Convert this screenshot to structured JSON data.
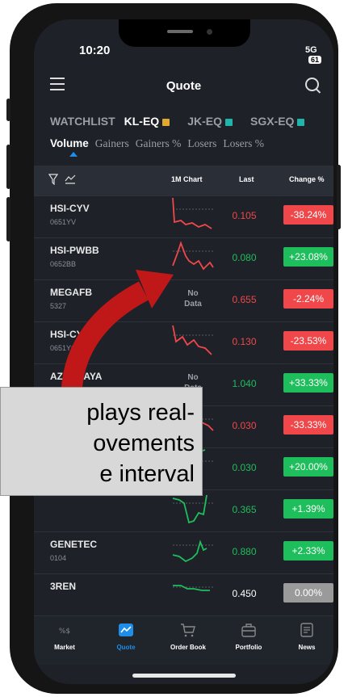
{
  "status_bar": {
    "time": "10:20",
    "network": "5G",
    "battery": "61"
  },
  "header": {
    "title": "Quote"
  },
  "market_tabs": [
    {
      "label": "WATCHLIST",
      "active": false,
      "marker_color": ""
    },
    {
      "label": "KL-EQ",
      "active": true,
      "marker_color": "#e0a82e"
    },
    {
      "label": "JK-EQ",
      "active": false,
      "marker_color": "#1fb5a8"
    },
    {
      "label": "SGX-EQ",
      "active": false,
      "marker_color": "#1fb5a8"
    }
  ],
  "sub_tabs": [
    {
      "label": "Volume",
      "active": true
    },
    {
      "label": "Gainers",
      "active": false
    },
    {
      "label": "Gainers %",
      "active": false
    },
    {
      "label": "Losers",
      "active": false
    },
    {
      "label": "Losers %",
      "active": false
    }
  ],
  "table": {
    "headers": {
      "chart": "1M Chart",
      "last": "Last",
      "change": "Change %"
    },
    "rows": [
      {
        "symbol": "HSI-CYV",
        "code": "0651YV",
        "chart": "red",
        "last": "0.105",
        "change": "-38.24%",
        "direction": "down"
      },
      {
        "symbol": "HSI-PWBB",
        "code": "0652BB",
        "chart": "red",
        "last": "0.080",
        "change": "+23.08%",
        "direction": "up"
      },
      {
        "symbol": "MEGAFB",
        "code": "5327",
        "chart": "none",
        "nodata": "No\nData",
        "last": "0.655",
        "change": "-2.24%",
        "direction": "down"
      },
      {
        "symbol": "HSI-CY",
        "code": "0651YC",
        "chart": "red",
        "last": "0.130",
        "change": "-23.53%",
        "direction": "down"
      },
      {
        "symbol": "AZAMJAYA",
        "code": "",
        "chart": "none",
        "nodata": "No\nData",
        "last": "1.040",
        "change": "+33.33%",
        "direction": "up"
      },
      {
        "symbol": "",
        "code": "",
        "chart": "red",
        "last": "0.030",
        "change": "-33.33%",
        "direction": "down"
      },
      {
        "symbol": "",
        "code": "",
        "chart": "green",
        "last": "0.030",
        "change": "+20.00%",
        "direction": "up"
      },
      {
        "symbol": "",
        "code": "",
        "chart": "green",
        "last": "0.365",
        "change": "+1.39%",
        "direction": "up"
      },
      {
        "symbol": "GENETEC",
        "code": "0104",
        "chart": "green",
        "last": "0.880",
        "change": "+2.33%",
        "direction": "up"
      },
      {
        "symbol": "3REN",
        "code": "",
        "chart": "green",
        "last": "0.450",
        "change": "0.00%",
        "direction": "flat"
      }
    ]
  },
  "bottom_nav": [
    {
      "label": "Market",
      "icon": "market-icon",
      "active": false
    },
    {
      "label": "Quote",
      "icon": "chart-icon",
      "active": true
    },
    {
      "label": "Order Book",
      "icon": "cart-icon",
      "active": false
    },
    {
      "label": "Portfolio",
      "icon": "briefcase-icon",
      "active": false
    },
    {
      "label": "News",
      "icon": "news-icon",
      "active": false
    }
  ],
  "callout": {
    "text": "plays real-\novements\ne interval"
  },
  "colors": {
    "up": "#1fbe5c",
    "down": "#f0474a",
    "flat": "#9a9a9a",
    "accent": "#1e8ee8",
    "arrow": "#c01818"
  }
}
